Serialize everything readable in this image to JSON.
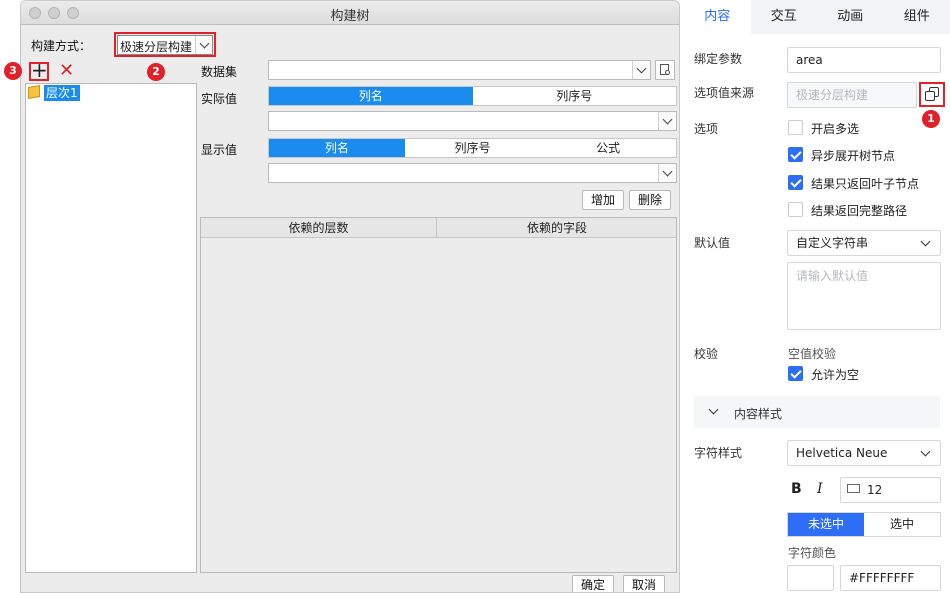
{
  "dialog": {
    "title": "构建树",
    "build_method_label": "构建方式：",
    "build_method_value": "极速分层构建",
    "tree_node": "层次1",
    "dataset_label": "数据集",
    "actual_value_label": "实际值",
    "actual_tabs": [
      "列名",
      "列序号"
    ],
    "display_value_label": "显示值",
    "display_tabs": [
      "列名",
      "列序号",
      "公式"
    ],
    "add_label": "增加",
    "delete_label": "删除",
    "table_headers": [
      "依赖的层数",
      "依赖的字段"
    ],
    "ok_label": "确定",
    "cancel_label": "取消",
    "badges": [
      "1",
      "2",
      "3"
    ]
  },
  "panel": {
    "tabs": [
      "内容",
      "交互",
      "动画",
      "组件"
    ],
    "bind_param_label": "绑定参数",
    "bind_param_value": "area",
    "option_source_label": "选项值来源",
    "option_source_value": "极速分层构建",
    "options_label": "选项",
    "checkboxes": [
      {
        "label": "开启多选",
        "checked": false
      },
      {
        "label": "异步展开树节点",
        "checked": true
      },
      {
        "label": "结果只返回叶子节点",
        "checked": true
      },
      {
        "label": "结果返回完整路径",
        "checked": false
      }
    ],
    "default_label": "默认值",
    "default_type": "自定义字符串",
    "default_placeholder": "请输入默认值",
    "validate_label": "校验",
    "empty_check_label": "空值校验",
    "allow_empty_label": "允许为空",
    "content_style_label": "内容样式",
    "char_style_label": "字符样式",
    "font_value": "Helvetica Neue",
    "bold": "B",
    "italic": "I",
    "font_size": "12",
    "unselected_label": "未选中",
    "selected_label": "选中",
    "char_color_label": "字符颜色",
    "color_value": "#FFFFFFFF"
  },
  "colors": {
    "accent_blue": "#1a8cf0",
    "panel_blue": "#2e6df5",
    "annotation_red": "#e0202b"
  }
}
